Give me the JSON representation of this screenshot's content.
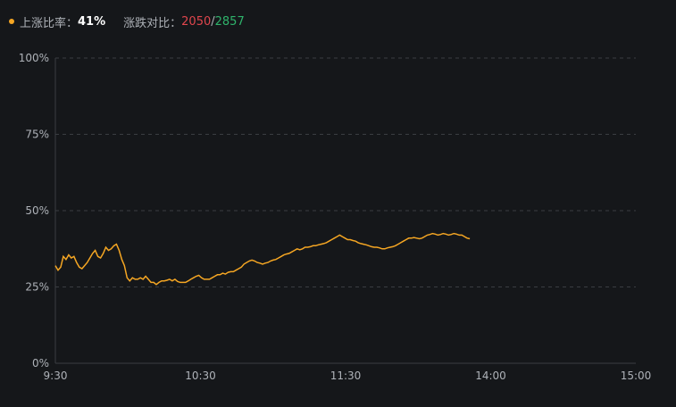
{
  "header": {
    "rise_ratio_label": "上涨比率：",
    "rise_ratio_value": "41%",
    "updown_label": "涨跌对比：",
    "up_count": "2050",
    "separator": "/",
    "down_count": "2857"
  },
  "colors": {
    "background": "#15171a",
    "line": "#f5a623",
    "up": "#e0464d",
    "down": "#2fb36b",
    "grid": "#3a3d42"
  },
  "chart_data": {
    "type": "line",
    "y_tick_labels": [
      "0%",
      "25%",
      "50%",
      "75%",
      "100%"
    ],
    "x_tick_labels": [
      "9:30",
      "10:30",
      "11:30",
      "14:00",
      "15:00"
    ],
    "ylim": [
      0,
      100
    ],
    "grid": "horizontal dashed",
    "series": [
      {
        "values": [
          32,
          30.5,
          31.5,
          35,
          34,
          35.5,
          34.5,
          35,
          33,
          31.5,
          31,
          32,
          33,
          34.5,
          36,
          37,
          35,
          34.5,
          36,
          38,
          37,
          37.5,
          38.5,
          39,
          37,
          34,
          32,
          28,
          27,
          28,
          27.5,
          27.5,
          28,
          27.5,
          28.5,
          27.5,
          26.5,
          26.5,
          25.8,
          26.5,
          27,
          27,
          27.2,
          27.5,
          27,
          27.5,
          26.8,
          26.5,
          26.5,
          26.5,
          27,
          27.5,
          28,
          28.5,
          28.8,
          28,
          27.5,
          27.5,
          27.5,
          28,
          28.5,
          29,
          29,
          29.5,
          29.2,
          29.8,
          30,
          30,
          30.5,
          31,
          31.5,
          32.5,
          33,
          33.5,
          33.8,
          33.5,
          33,
          32.8,
          32.5,
          32.8,
          33,
          33.5,
          33.8,
          34,
          34.5,
          35,
          35.5,
          35.8,
          36,
          36.5,
          37,
          37.5,
          37.2,
          37.5,
          38,
          38,
          38.2,
          38.5,
          38.5,
          38.8,
          39,
          39.2,
          39.5,
          40,
          40.5,
          41,
          41.5,
          42,
          41.5,
          41,
          40.5,
          40.5,
          40.2,
          40,
          39.5,
          39.2,
          39,
          38.8,
          38.5,
          38.2,
          38,
          38,
          37.8,
          37.5,
          37.5,
          37.8,
          38,
          38.2,
          38.5,
          39,
          39.5,
          40,
          40.5,
          41,
          41,
          41.2,
          41,
          40.8,
          41,
          41.5,
          42,
          42.2,
          42.5,
          42.3,
          42,
          42.2,
          42.5,
          42.3,
          42,
          42.2,
          42.5,
          42.3,
          42,
          42,
          41.5,
          41,
          40.8
        ]
      }
    ]
  }
}
